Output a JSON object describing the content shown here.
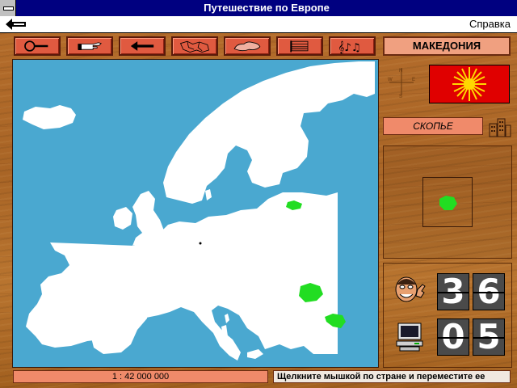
{
  "window": {
    "title": "Путешествие по Европе"
  },
  "menu": {
    "help": "Справка"
  },
  "toolbar": {
    "buttons": [
      {
        "name": "zoom-magnifier-button",
        "icon": "magnifier-icon"
      },
      {
        "name": "pointing-hand-button",
        "icon": "pointing-hand-icon"
      },
      {
        "name": "back-arrow-button",
        "icon": "left-arrow-icon"
      },
      {
        "name": "country-borders-button",
        "icon": "borders-map-icon"
      },
      {
        "name": "terrain-map-button",
        "icon": "terrain-map-icon"
      },
      {
        "name": "flags-button",
        "icon": "striped-flag-icon"
      },
      {
        "name": "music-button",
        "icon": "music-notes-icon"
      }
    ]
  },
  "country": {
    "name": "МАКЕДОНИЯ"
  },
  "capital": {
    "name": "СКОПЬЕ"
  },
  "counters": {
    "player": [
      "3",
      "6"
    ],
    "computer": [
      "0",
      "5"
    ]
  },
  "status": {
    "scale": "1 : 42 000 000",
    "hint": "Щелкните мышкой по стране и переместите ее"
  },
  "colors": {
    "sea": "#4aa8d0",
    "land": "#ffffff",
    "highlight": "#22dd22",
    "flag_red": "#e00000",
    "flag_sun": "#ffd800"
  }
}
